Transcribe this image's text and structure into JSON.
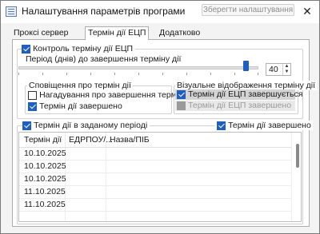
{
  "window": {
    "title": "Налаштування параметрів програми",
    "close_glyph": "✕"
  },
  "tabs": [
    {
      "label": "Проксі сервер"
    },
    {
      "label": "Термін дії ЕЦП",
      "active": true
    },
    {
      "label": "Додатково"
    }
  ],
  "cert_group": {
    "checkbox_label": "Контроль терміну дії ЕЦП",
    "checked": true,
    "save_button": "Зберегти налаштування",
    "period_label": "Період (днів) до завершення терміну дії",
    "period_value": "40",
    "slider_fraction": 0.96
  },
  "notify_group": {
    "title": "Сповіщення про термін дії",
    "items": [
      {
        "label": "Нагадування про завершення терміну",
        "checked": false
      },
      {
        "label": "Термін дії завершено",
        "checked": true
      }
    ]
  },
  "visual_group": {
    "title": "Візуальне відображення терміну дії",
    "items": [
      {
        "label": "Термін дії ЕЦП завершується",
        "checked": true
      },
      {
        "label": "Термін дії ЕЦП завершено",
        "checked": true,
        "disabled": true
      }
    ]
  },
  "period_group": {
    "checkbox_label": "Термін дії в заданому періоді",
    "checked": true,
    "expired_label": "Термін дії завершено",
    "expired_checked": true
  },
  "grid": {
    "columns": [
      "Термін дії",
      "ЕДРПОУ/...",
      "Назва/ПІБ"
    ],
    "rows": [
      [
        "10.10.2025",
        "",
        ""
      ],
      [
        "10.10.2025",
        "",
        ""
      ],
      [
        "10.10.2025",
        "",
        ""
      ],
      [
        "11.10.2025",
        "",
        ""
      ],
      [
        "11.10.2025",
        "",
        ""
      ]
    ]
  }
}
